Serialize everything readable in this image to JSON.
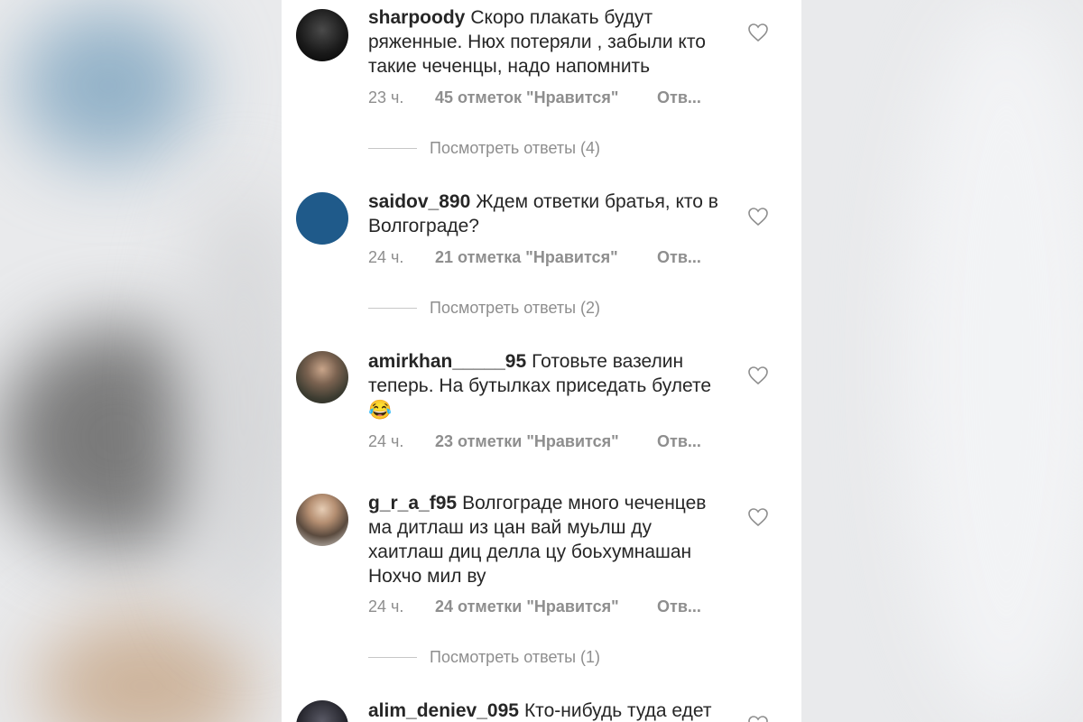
{
  "comments": [
    {
      "username": "sharpoody",
      "text": "Скоро плакать будут ряженные. Нюх потеряли , забыли кто такие чеченцы, надо напомнить",
      "time": "23 ч.",
      "likes": "45 отметок \"Нравится\"",
      "reply": "Отв...",
      "view_replies": "Посмотреть ответы (4)"
    },
    {
      "username": "saidov_890",
      "text": "Ждем ответки братья, кто в Волгограде?",
      "time": "24 ч.",
      "likes": "21 отметка \"Нравится\"",
      "reply": "Отв...",
      "view_replies": "Посмотреть ответы (2)"
    },
    {
      "username": "amirkhan_____95",
      "text": "Готовьте вазелин теперь. На бутылках приседать булете😂",
      "time": "24 ч.",
      "likes": "23 отметки \"Нравится\"",
      "reply": "Отв..."
    },
    {
      "username": "g_r_a_f95",
      "text": "Волгограде много чеченцев ма дитлаш из цан вай муьлш ду хаитлаш диц делла цу боьхумнашан Нохчо мил ву",
      "time": "24 ч.",
      "likes": "24 отметки \"Нравится\"",
      "reply": "Отв...",
      "view_replies": "Посмотреть ответы (1)"
    },
    {
      "username": "alim_deniev_095",
      "text": "Кто-нибудь туда едет"
    }
  ],
  "colors": {
    "text": "#262626",
    "muted": "#8e8e8e",
    "avatar_blue": "#1f5a8a"
  }
}
